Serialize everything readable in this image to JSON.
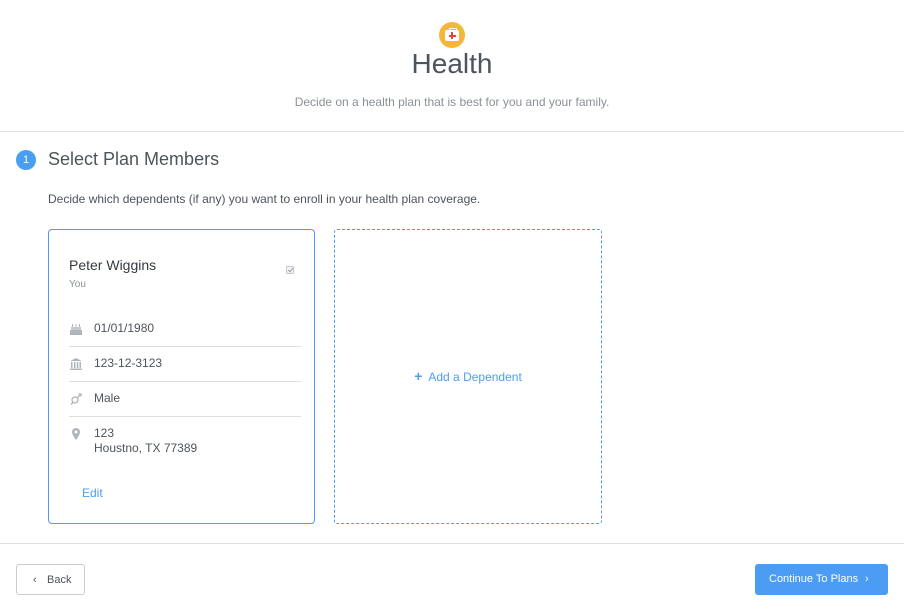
{
  "header": {
    "icon": "first-aid-kit-icon",
    "title": "Health",
    "subtitle": "Decide on a health plan that is best for you and your family."
  },
  "step": {
    "number": "1",
    "title": "Select Plan Members",
    "description": "Decide which dependents (if any) you want to enroll in your health plan coverage."
  },
  "member": {
    "name": "Peter Wiggins",
    "relation": "You",
    "checked": true,
    "dob": "01/01/1980",
    "ssn": "123-12-3123",
    "gender": "Male",
    "address_line1": "123",
    "address_line2": "Houstno, TX 77389",
    "edit_label": "Edit"
  },
  "add_dependent": {
    "label": "Add a Dependent"
  },
  "footer": {
    "back_label": "Back",
    "continue_label": "Continue To Plans"
  },
  "colors": {
    "accent": "#4a9df3",
    "header_icon": "#f6b53b"
  }
}
